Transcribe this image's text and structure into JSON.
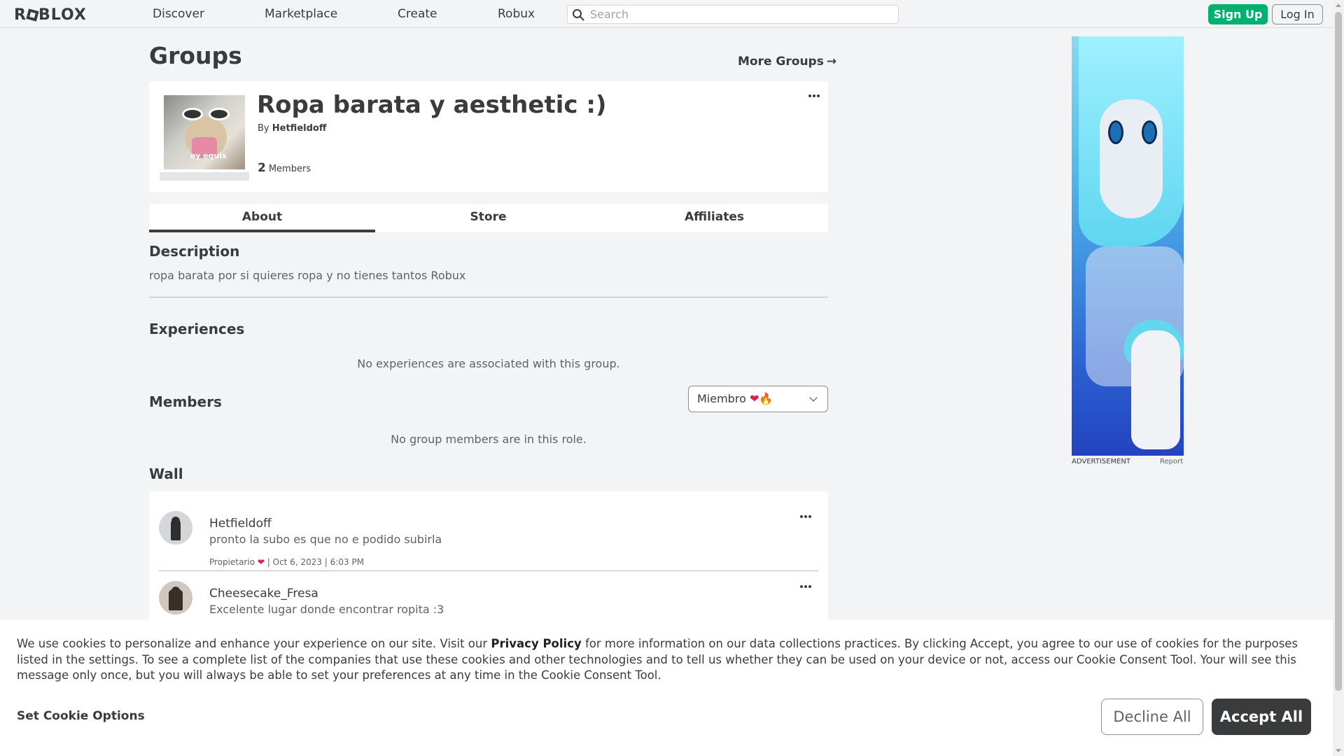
{
  "header": {
    "logo": "ROBLOX",
    "nav": [
      "Discover",
      "Marketplace",
      "Create",
      "Robux"
    ],
    "search_placeholder": "Search",
    "signup": "Sign Up",
    "login": "Log In"
  },
  "page": {
    "title": "Groups",
    "more_groups": "More Groups",
    "more_groups_arrow": "→"
  },
  "group": {
    "name": "Ropa barata y aesthetic :)",
    "by_prefix": "By",
    "owner": "Hetfieldoff",
    "member_count": "2",
    "members_label": "Members",
    "thumbnail_caption": "ay equis"
  },
  "tabs": [
    "About",
    "Store",
    "Affiliates"
  ],
  "about": {
    "description_title": "Description",
    "description": "ropa barata por si quieres ropa y no tienes tantos Robux",
    "experiences_title": "Experiences",
    "experiences_empty": "No experiences are associated with this group.",
    "members_title": "Members",
    "role_selected": "Miembro",
    "role_emoji_heart": "❤",
    "role_emoji_flame": "🔥",
    "members_empty": "No group members are in this role.",
    "wall_title": "Wall"
  },
  "wall_posts": [
    {
      "user": "Hetfieldoff",
      "body": "pronto la subo es que no e podido subirla",
      "role": "Propietario",
      "role_emoji": "❤",
      "timestamp": "| Oct 6, 2023 | 6:03 PM"
    },
    {
      "user": "Cheesecake_Fresa",
      "body": "Excelente lugar donde encontrar ropita :3"
    }
  ],
  "ad": {
    "label": "ADVERTISEMENT",
    "report": "Report"
  },
  "cookie_banner": {
    "text_before_link": "We use cookies to personalize and enhance your experience on our site. Visit our ",
    "link": "Privacy Policy",
    "text_after_link": " for more information on our data collections practices. By clicking Accept, you agree to our use of cookies for the purposes listed in the settings. To see a complete list of the companies that use these cookies and other technologies and to tell us whether they can be used on your device or not, access our Cookie Consent Tool. Your will see this message only once, but you will always be able to set your preferences at any time in the Cookie Consent Tool.",
    "options": "Set Cookie Options",
    "decline": "Decline All",
    "accept": "Accept All"
  },
  "colors": {
    "accent_green": "#00b06f",
    "text": "#393b3d",
    "background": "#f2f4f5"
  }
}
